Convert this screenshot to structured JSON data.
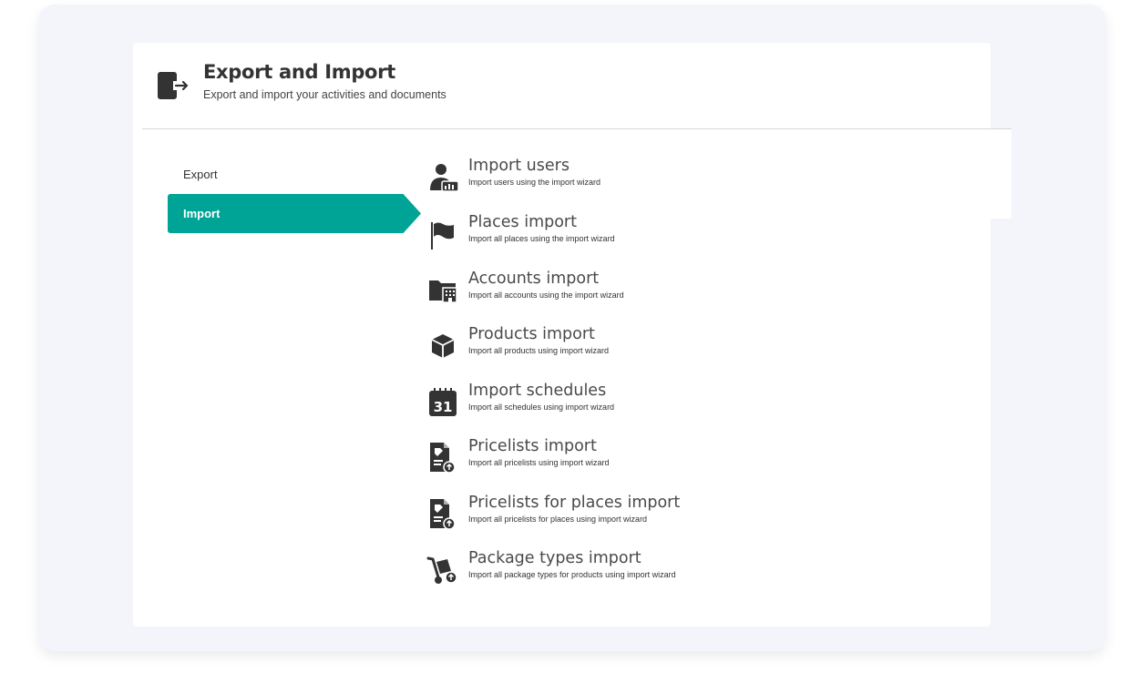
{
  "header": {
    "title": "Export and Import",
    "subtitle": "Export and import your activities and documents",
    "icon": "export-import-icon"
  },
  "nav": {
    "export_label": "Export",
    "import_label": "Import",
    "active": "Import",
    "accent": "#00a497"
  },
  "imports": [
    {
      "title": "Import users",
      "desc": "Import users using the import wizard",
      "icon": "user-import-icon"
    },
    {
      "title": "Places import",
      "desc": "Import all places using the import wizard",
      "icon": "flag-icon"
    },
    {
      "title": "Accounts import",
      "desc": "Import all accounts using the import wizard",
      "icon": "folder-building-icon"
    },
    {
      "title": "Products import",
      "desc": "Import all products using import wizard",
      "icon": "box-icon"
    },
    {
      "title": "Import schedules",
      "desc": "Import all schedules using import wizard",
      "icon": "calendar-icon"
    },
    {
      "title": "Pricelists import",
      "desc": "Import all pricelists using import wizard",
      "icon": "pricelist-upload-icon"
    },
    {
      "title": "Pricelists for places import",
      "desc": "Import all pricelists for places using import wizard",
      "icon": "pricelist-upload-icon"
    },
    {
      "title": "Package types import",
      "desc": "Import all package types for products using import wizard",
      "icon": "hand-truck-icon"
    }
  ],
  "calendar_day": "31"
}
